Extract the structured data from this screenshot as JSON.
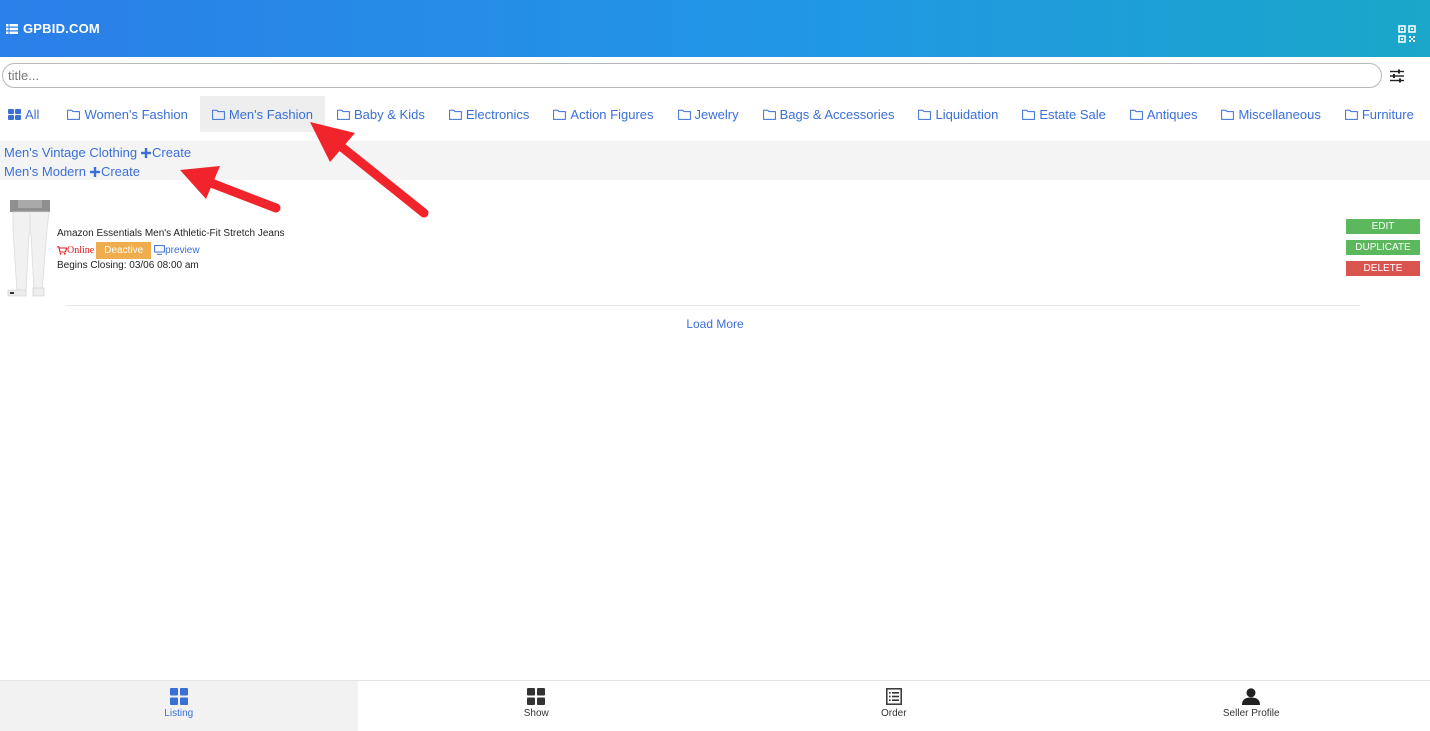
{
  "header": {
    "brand": "GPBID.COM"
  },
  "search": {
    "placeholder": "title..."
  },
  "categories": [
    {
      "label": "All"
    },
    {
      "label": "Women's Fashion"
    },
    {
      "label": "Men's Fashion"
    },
    {
      "label": "Baby & Kids"
    },
    {
      "label": "Electronics"
    },
    {
      "label": "Action Figures"
    },
    {
      "label": "Jewelry"
    },
    {
      "label": "Bags & Accessories"
    },
    {
      "label": "Liquidation"
    },
    {
      "label": "Estate Sale"
    },
    {
      "label": "Antiques"
    },
    {
      "label": "Miscellaneous"
    },
    {
      "label": "Furniture"
    }
  ],
  "subcategories": [
    {
      "label": "Men's Vintage Clothing",
      "create": "Create"
    },
    {
      "label": "Men's Modern",
      "create": "Create"
    }
  ],
  "listing": {
    "title": "Amazon Essentials Men's Athletic-Fit Stretch Jeans",
    "status": "Online",
    "deactive": "Deactive",
    "preview": "preview",
    "closing": "Begins Closing: 03/06 08:00 am",
    "actions": {
      "edit": "EDIT",
      "duplicate": "DUPLICATE",
      "delete": "DELETE"
    }
  },
  "load_more": "Load More",
  "nav": [
    {
      "label": "Listing"
    },
    {
      "label": "Show"
    },
    {
      "label": "Order"
    },
    {
      "label": "Seller Profile"
    }
  ],
  "colors": {
    "link": "#3a6fd8",
    "edit": "#5cb85c",
    "delete": "#d9534f",
    "deactive": "#f0ad4e",
    "online": "#e81b1b",
    "annotation_arrow": "#f0242a"
  }
}
